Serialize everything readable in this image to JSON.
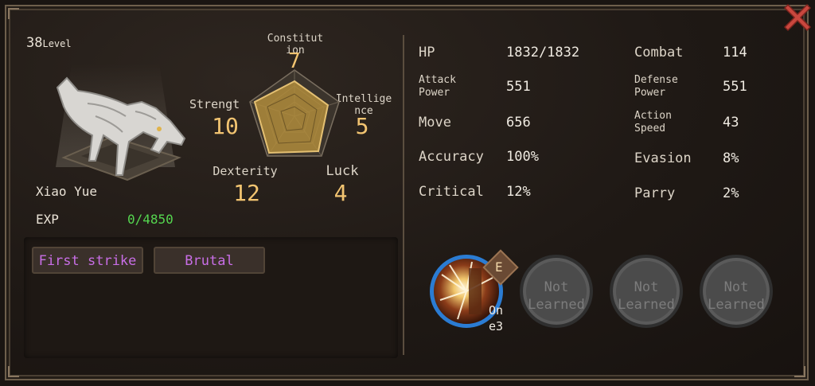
{
  "pet": {
    "level": "38",
    "level_word": "Level",
    "name": "Xiao Yue",
    "exp_label": "EXP",
    "exp_value": "0/4850"
  },
  "attributes": {
    "constitution": {
      "label_line1": "Constitut",
      "label_line2": "ion",
      "value": "7"
    },
    "strength": {
      "label": "Strengt",
      "value": "10"
    },
    "intelligence": {
      "label_line1": "Intellige",
      "label_line2": "nce",
      "value": "5"
    },
    "dexterity": {
      "label": "Dexterity",
      "value": "12"
    },
    "luck": {
      "label": "Luck",
      "value": "4"
    }
  },
  "traits": [
    "First strike",
    "Brutal"
  ],
  "stats": {
    "hp": {
      "label": "HP",
      "value": "1832/1832"
    },
    "combat": {
      "label": "Combat",
      "value": "114"
    },
    "attack_power": {
      "label_line1": "Attack",
      "label_line2": "Power",
      "value": "551"
    },
    "defense_power": {
      "label_line1": "Defense",
      "label_line2": "Power",
      "value": "551"
    },
    "move": {
      "label": "Move",
      "value": "656"
    },
    "action_speed": {
      "label_line1": "Action",
      "label_line2": "Speed",
      "value": "43"
    },
    "accuracy": {
      "label": "Accuracy",
      "value": "100%"
    },
    "evasion": {
      "label": "Evasion",
      "value": "8%"
    },
    "critical": {
      "label": "Critical",
      "value": "12%"
    },
    "parry": {
      "label": "Parry",
      "value": "2%"
    }
  },
  "skills": {
    "active_badge": "E",
    "active_sub_line1": "On",
    "active_sub_line2": "e3",
    "locked_line1": "Not",
    "locked_line2": "Learned"
  },
  "colors": {
    "accent_value": "#f2c471",
    "trait_text": "#c86ee6",
    "exp_text": "#55d64f",
    "close_red": "#c9473e"
  },
  "icons": [
    "close-icon",
    "wolf-portrait",
    "radar-chart",
    "skill-icon"
  ]
}
